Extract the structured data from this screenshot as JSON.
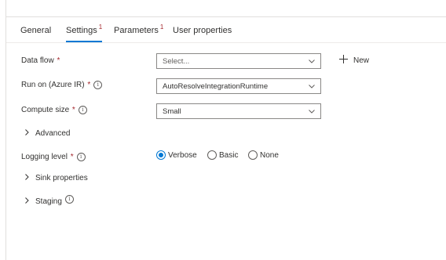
{
  "tabs": [
    {
      "label": "General",
      "badge": ""
    },
    {
      "label": "Settings",
      "badge": "1"
    },
    {
      "label": "Parameters",
      "badge": "1"
    },
    {
      "label": "User properties",
      "badge": ""
    }
  ],
  "active_tab": "Settings",
  "form": {
    "data_flow": {
      "label": "Data flow",
      "required_mark": "*",
      "placeholder": "Select...",
      "new_label": "New"
    },
    "run_on": {
      "label": "Run on (Azure IR)",
      "required_mark": "*",
      "info_glyph": "i",
      "value": "AutoResolveIntegrationRuntime"
    },
    "compute_size": {
      "label": "Compute size",
      "required_mark": "*",
      "info_glyph": "i",
      "value": "Small"
    },
    "advanced": {
      "label": "Advanced"
    },
    "logging_level": {
      "label": "Logging level",
      "required_mark": "*",
      "info_glyph": "i",
      "options": [
        "Verbose",
        "Basic",
        "None"
      ],
      "selected": "Verbose"
    },
    "sink_properties": {
      "label": "Sink properties"
    },
    "staging": {
      "label": "Staging",
      "info_glyph": "i"
    }
  },
  "colors": {
    "accent": "#0078d4",
    "required": "#a4262c",
    "text": "#323130",
    "border": "#8a8886"
  },
  "icons": {
    "dropdown": "chevron-down-icon",
    "expander": "chevron-right-icon",
    "info": "info-icon",
    "new": "plus-icon"
  }
}
